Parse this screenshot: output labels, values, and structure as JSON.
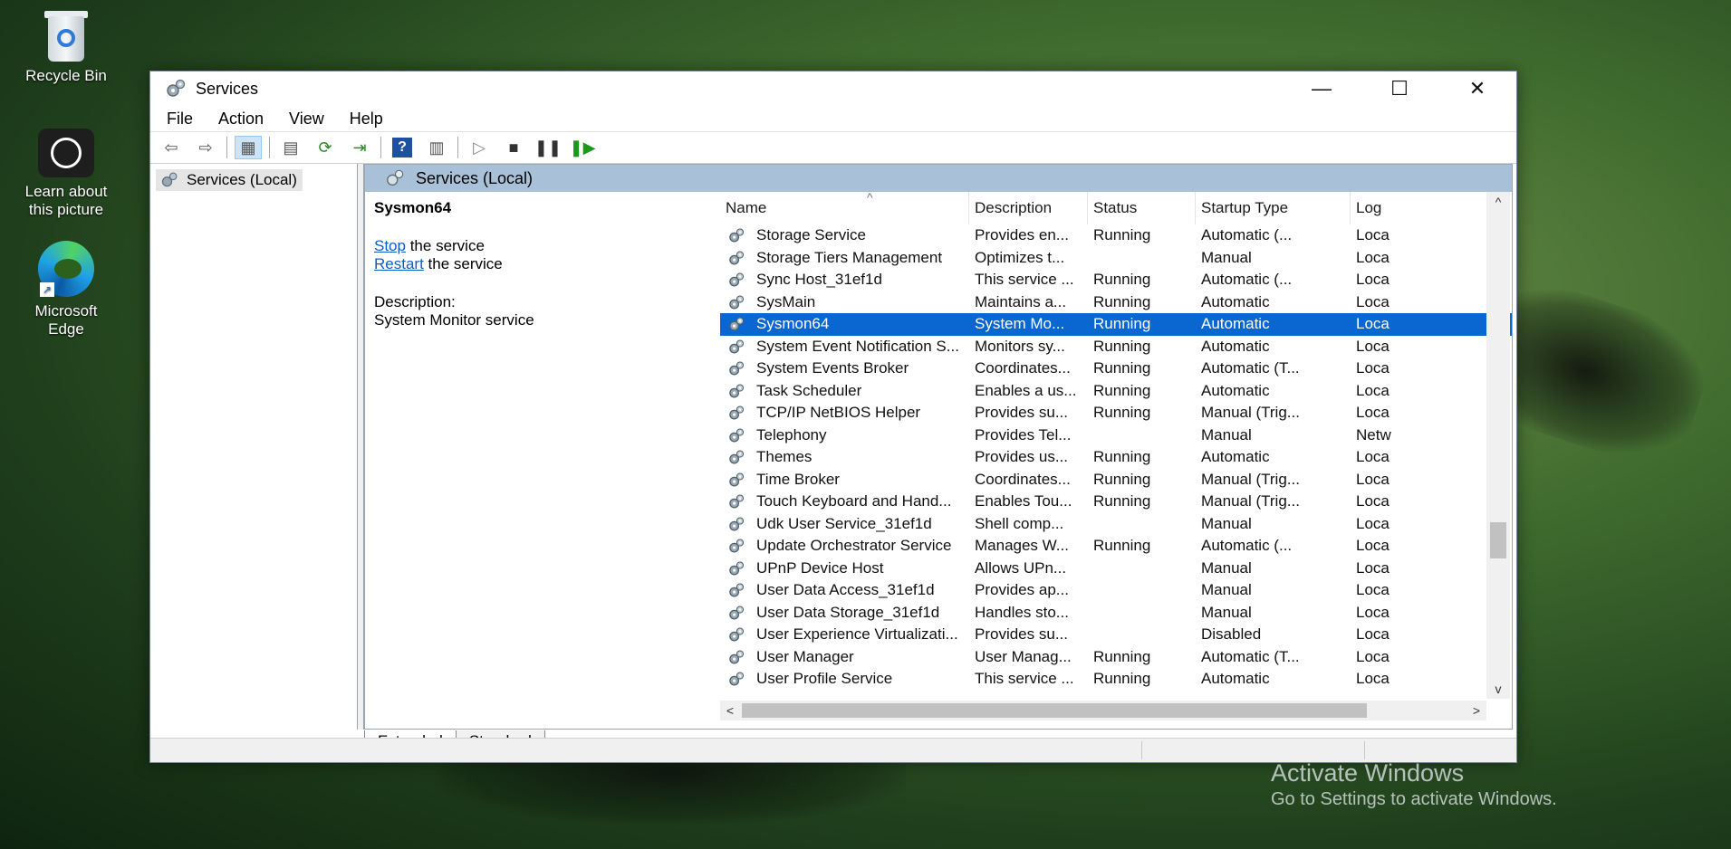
{
  "desktop": {
    "icons": [
      {
        "label": "Recycle Bin",
        "icon": "recycle-bin-icon"
      },
      {
        "label": "Learn about this picture",
        "icon": "camera-icon"
      },
      {
        "label": "Microsoft Edge",
        "icon": "edge-icon"
      }
    ],
    "watermark": {
      "line1": "Activate Windows",
      "line2": "Go to Settings to activate Windows."
    }
  },
  "window": {
    "title": "Services",
    "controls": {
      "minimize": "—",
      "maximize": "☐",
      "close": "✕"
    },
    "menu": [
      "File",
      "Action",
      "View",
      "Help"
    ],
    "tree_item": "Services (Local)",
    "pane_title": "Services (Local)",
    "detail": {
      "service_name": "Sysmon64",
      "stop_link": "Stop",
      "stop_text": " the service",
      "restart_link": "Restart",
      "restart_text": " the service",
      "desc_label": "Description:",
      "desc_text": "System Monitor service"
    },
    "columns": [
      "Name",
      "Description",
      "Status",
      "Startup Type",
      "Log"
    ],
    "rows": [
      {
        "name": "Storage Service",
        "desc": "Provides en...",
        "status": "Running",
        "startup": "Automatic (...",
        "log": "Loca"
      },
      {
        "name": "Storage Tiers Management",
        "desc": "Optimizes t...",
        "status": "",
        "startup": "Manual",
        "log": "Loca"
      },
      {
        "name": "Sync Host_31ef1d",
        "desc": "This service ...",
        "status": "Running",
        "startup": "Automatic (...",
        "log": "Loca"
      },
      {
        "name": "SysMain",
        "desc": "Maintains a...",
        "status": "Running",
        "startup": "Automatic",
        "log": "Loca"
      },
      {
        "name": "Sysmon64",
        "desc": "System Mo...",
        "status": "Running",
        "startup": "Automatic",
        "log": "Loca",
        "selected": true
      },
      {
        "name": "System Event Notification S...",
        "desc": "Monitors sy...",
        "status": "Running",
        "startup": "Automatic",
        "log": "Loca"
      },
      {
        "name": "System Events Broker",
        "desc": "Coordinates...",
        "status": "Running",
        "startup": "Automatic (T...",
        "log": "Loca"
      },
      {
        "name": "Task Scheduler",
        "desc": "Enables a us...",
        "status": "Running",
        "startup": "Automatic",
        "log": "Loca"
      },
      {
        "name": "TCP/IP NetBIOS Helper",
        "desc": "Provides su...",
        "status": "Running",
        "startup": "Manual (Trig...",
        "log": "Loca"
      },
      {
        "name": "Telephony",
        "desc": "Provides Tel...",
        "status": "",
        "startup": "Manual",
        "log": "Netw"
      },
      {
        "name": "Themes",
        "desc": "Provides us...",
        "status": "Running",
        "startup": "Automatic",
        "log": "Loca"
      },
      {
        "name": "Time Broker",
        "desc": "Coordinates...",
        "status": "Running",
        "startup": "Manual (Trig...",
        "log": "Loca"
      },
      {
        "name": "Touch Keyboard and Hand...",
        "desc": "Enables Tou...",
        "status": "Running",
        "startup": "Manual (Trig...",
        "log": "Loca"
      },
      {
        "name": "Udk User Service_31ef1d",
        "desc": "Shell comp...",
        "status": "",
        "startup": "Manual",
        "log": "Loca"
      },
      {
        "name": "Update Orchestrator Service",
        "desc": "Manages W...",
        "status": "Running",
        "startup": "Automatic (...",
        "log": "Loca"
      },
      {
        "name": "UPnP Device Host",
        "desc": "Allows UPn...",
        "status": "",
        "startup": "Manual",
        "log": "Loca"
      },
      {
        "name": "User Data Access_31ef1d",
        "desc": "Provides ap...",
        "status": "",
        "startup": "Manual",
        "log": "Loca"
      },
      {
        "name": "User Data Storage_31ef1d",
        "desc": "Handles sto...",
        "status": "",
        "startup": "Manual",
        "log": "Loca"
      },
      {
        "name": "User Experience Virtualizati...",
        "desc": "Provides su...",
        "status": "",
        "startup": "Disabled",
        "log": "Loca"
      },
      {
        "name": "User Manager",
        "desc": "User Manag...",
        "status": "Running",
        "startup": "Automatic (T...",
        "log": "Loca"
      },
      {
        "name": "User Profile Service",
        "desc": "This service ...",
        "status": "Running",
        "startup": "Automatic",
        "log": "Loca"
      }
    ],
    "tabs": [
      "Extended",
      "Standard"
    ],
    "colors": {
      "selection": "#0a67d2",
      "pane_header": "#a9c1d8",
      "link": "#0b5fc8"
    }
  }
}
